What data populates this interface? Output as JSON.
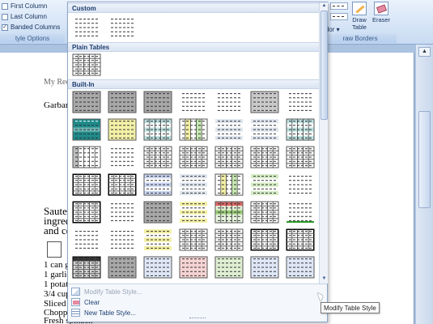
{
  "ribbon": {
    "options": [
      {
        "label": "First Column",
        "checked": false
      },
      {
        "label": "Last Column",
        "checked": false
      },
      {
        "label": "Banded Columns",
        "checked": true
      }
    ],
    "options_group_label": "tyle Options",
    "borders_group_label": "raw Borders",
    "pen_color_label": "olor",
    "draw_table_label": "Draw Table",
    "eraser_label": "Eraser"
  },
  "document": {
    "lines": [
      "My Rec",
      "Garban",
      "Sauteed",
      "ingred",
      "and co",
      "1 can g",
      "1 garlic",
      "1 potat",
      "3/4 cup",
      "Sliced r",
      "Choppe",
      "Fresh spinach"
    ]
  },
  "gallery": {
    "sections": [
      "Custom",
      "Plain Tables",
      "Built-In"
    ],
    "menu": {
      "modify": "Modify Table Style...",
      "clear": "Clear",
      "new": "New Table Style..."
    },
    "tooltip": "Modify Table Style"
  },
  "colors": {
    "accent": "#1e3c6e",
    "teal": "#1f8a8a",
    "gray": "#a8a8a8",
    "yellow": "#f3f0a6",
    "green": "#9ccf7a",
    "red": "#e36a6a"
  }
}
